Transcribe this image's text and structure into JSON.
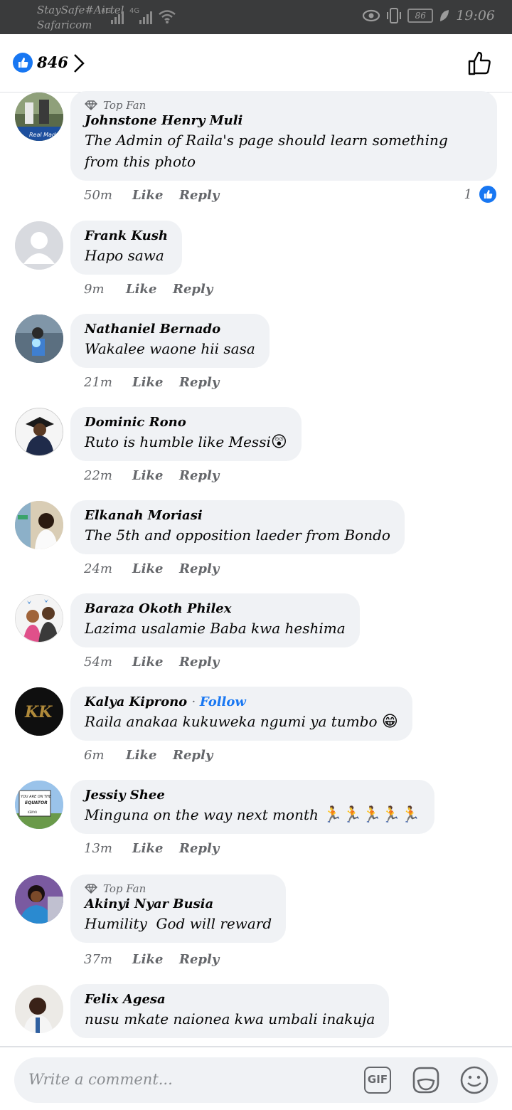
{
  "status_bar": {
    "carrier_line1": "StaySafe#Airtel",
    "carrier_line2": "Safaricom",
    "network1": "4G",
    "network2": "4G",
    "battery": "86",
    "time": "19:06"
  },
  "header": {
    "like_count": "846"
  },
  "comments": [
    {
      "name": "Johnstone Henry Muli",
      "badge": "Top Fan",
      "text": "The Admin of Raila's page should learn something from this photo",
      "time": "50m",
      "like": "Like",
      "reply": "Reply",
      "reactions": "1"
    },
    {
      "name": "Frank Kush",
      "text": "Hapo sawa",
      "time": "9m",
      "like": "Like",
      "reply": "Reply"
    },
    {
      "name": "Nathaniel Bernado",
      "text": "Wakalee waone hii sasa",
      "time": "21m",
      "like": "Like",
      "reply": "Reply"
    },
    {
      "name": "Dominic Rono",
      "text": "Ruto is humble like Messi",
      "emoji": "😲",
      "time": "22m",
      "like": "Like",
      "reply": "Reply"
    },
    {
      "name": "Elkanah Moriasi",
      "text": "The 5th and opposition laeder from Bondo",
      "time": "24m",
      "like": "Like",
      "reply": "Reply"
    },
    {
      "name": "Baraza Okoth Philex",
      "text": "Lazima usalamie Baba kwa heshima",
      "time": "54m",
      "like": "Like",
      "reply": "Reply"
    },
    {
      "name": "Kalya Kiprono",
      "follow": "Follow",
      "text": "Raila anakaa kukuweka ngumi ya tumbo ",
      "emoji": "😁",
      "time": "6m",
      "like": "Like",
      "reply": "Reply"
    },
    {
      "name": "Jessiy Shee",
      "text": "Minguna on the way next month ",
      "emoji": "🏃🏃🏃🏃🏃",
      "time": "13m",
      "like": "Like",
      "reply": "Reply"
    },
    {
      "name": "Akinyi Nyar Busia",
      "badge": "Top Fan",
      "text": "Humility  God will reward",
      "time": "37m",
      "like": "Like",
      "reply": "Reply"
    },
    {
      "name": "Felix Agesa",
      "text": "nusu mkate naionea kwa umbali inakuja"
    }
  ],
  "avatar_text": {
    "realmadrid": "Real Madr",
    "kk": "KK",
    "sign_line1": "YOU ARE ON THE",
    "sign_line2": "EQUATOR",
    "sign_line3": "KENYA"
  },
  "composer": {
    "placeholder": "Write a comment...",
    "gif_label": "GIF"
  },
  "colors": {
    "accent": "#1877f2",
    "bubble": "#f0f2f5",
    "muted": "#65676b",
    "statusbar": "#3a3b3c"
  }
}
